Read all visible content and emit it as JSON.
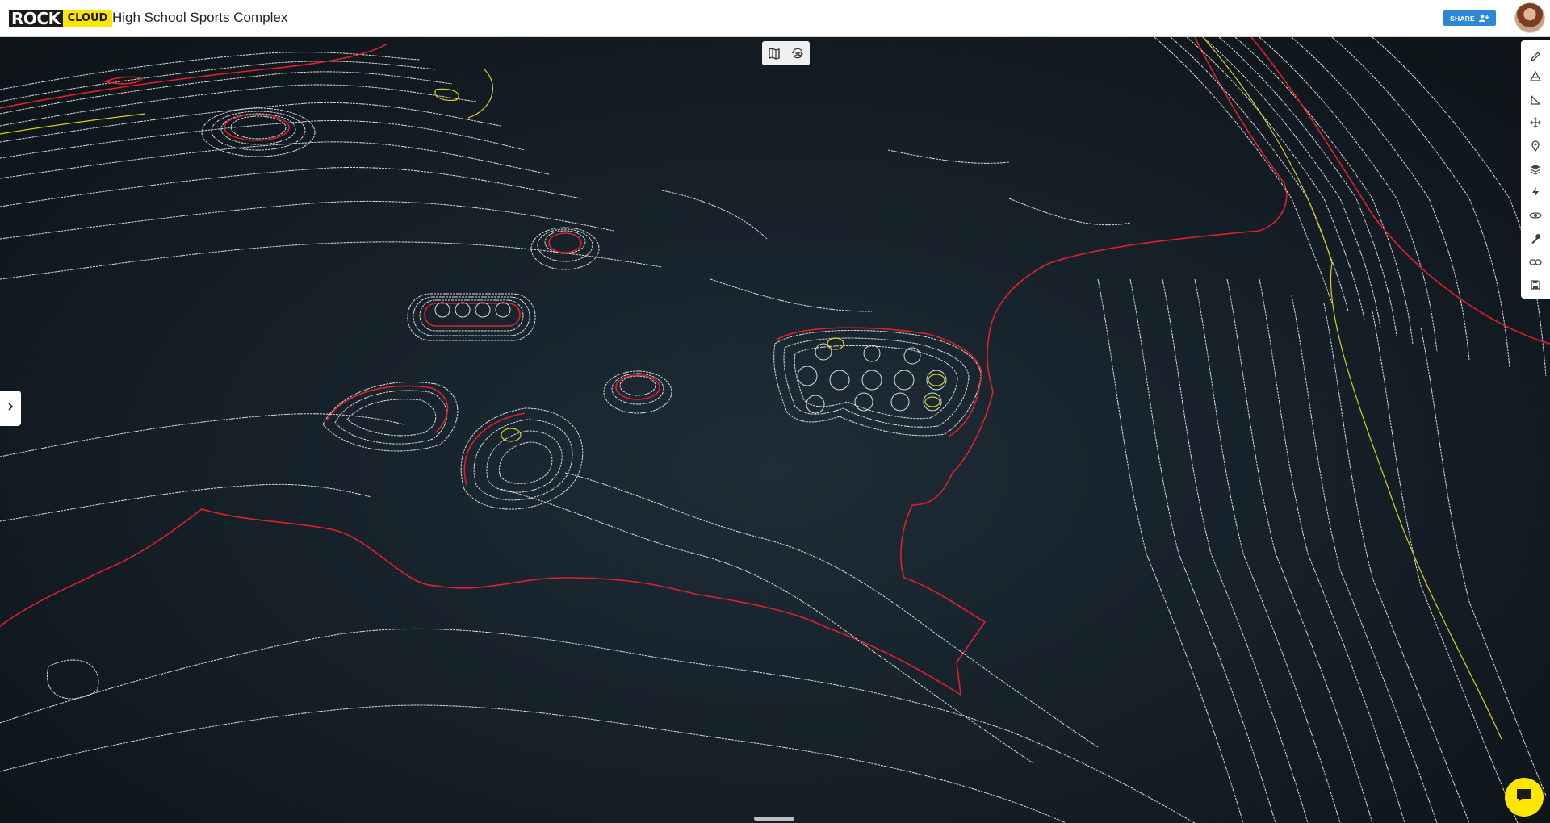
{
  "app": {
    "logo_rock": "ROCK",
    "logo_cloud": "CLOUD",
    "project_title": "High School Sports Complex"
  },
  "header": {
    "share_label": "SHARE",
    "share_icon": "add-user-icon",
    "avatar": "user-avatar"
  },
  "view_toggle": {
    "modes": [
      "map-icon",
      "3d-view-icon"
    ]
  },
  "toolbar": {
    "tools": [
      "pencil-icon",
      "volume-icon",
      "angle-measure-icon",
      "move-icon",
      "location-pin-icon",
      "layers-icon",
      "flash-icon",
      "eye-icon",
      "wrench-icon",
      "link-icon",
      "save-icon"
    ]
  },
  "colors": {
    "contour_main": "#d9dde0",
    "contour_index": "#e0202a",
    "contour_highlight": "#d8d020",
    "accent_yellow": "#ffe600",
    "share_blue": "#2f86d6"
  }
}
